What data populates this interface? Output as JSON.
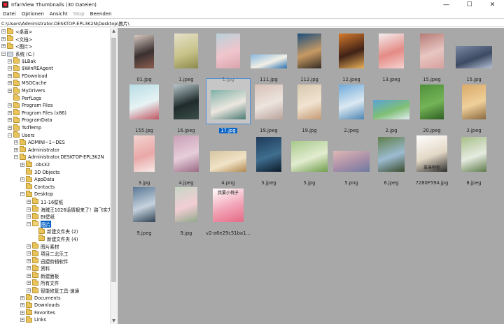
{
  "window": {
    "title": "IrfanView Thumbnails (30 Dateien)"
  },
  "menu": [
    "Datei",
    "Optionen",
    "Ansicht",
    "Stop",
    "Beenden"
  ],
  "path": "C:\\Users\\Administrator.DESKTOP-EPL3K2N\\Desktop\\图片\\",
  "tree": [
    {
      "label": "<桌面>",
      "expander": "+",
      "icon": "folder-icon"
    },
    {
      "label": "<文档>",
      "expander": "+",
      "icon": "folder-icon"
    },
    {
      "label": "<图片>",
      "expander": "+",
      "icon": "folder-icon"
    },
    {
      "label": "系统 (C:)",
      "expander": "−",
      "icon": "drive-icon"
    },
    {
      "label": "$LBak",
      "expander": "+",
      "icon": "folder-icon"
    },
    {
      "label": "$WinREAgent",
      "expander": "+",
      "icon": "folder-icon"
    },
    {
      "label": "FDownload",
      "expander": "+",
      "icon": "folder-icon"
    },
    {
      "label": "MSOCache",
      "expander": "+",
      "icon": "folder-icon"
    },
    {
      "label": "MyDrivers",
      "expander": "+",
      "icon": "folder-icon"
    },
    {
      "label": "PerfLogs",
      "expander": "",
      "icon": "folder-icon"
    },
    {
      "label": "Program Files",
      "expander": "+",
      "icon": "folder-icon"
    },
    {
      "label": "Program Files (x86)",
      "expander": "+",
      "icon": "folder-icon"
    },
    {
      "label": "ProgramData",
      "expander": "+",
      "icon": "folder-icon"
    },
    {
      "label": "TsdTemp",
      "expander": "+",
      "icon": "folder-icon"
    },
    {
      "label": "Users",
      "expander": "−",
      "icon": "folder-icon"
    },
    {
      "label": "ADMINI~1~DES",
      "expander": "+",
      "icon": "folder-icon"
    },
    {
      "label": "Administrator",
      "expander": "+",
      "icon": "folder-icon"
    },
    {
      "label": "Administrator.DESKTOP-EPL3K2N",
      "expander": "−",
      "icon": "folder-icon"
    },
    {
      "label": ".obs32",
      "expander": "+",
      "icon": "folder-icon"
    },
    {
      "label": "3D Objects",
      "expander": "",
      "icon": "folder-icon"
    },
    {
      "label": "AppData",
      "expander": "+",
      "icon": "folder-icon"
    },
    {
      "label": "Contacts",
      "expander": "",
      "icon": "folder-icon"
    },
    {
      "label": "Desktop",
      "expander": "−",
      "icon": "folder-icon"
    },
    {
      "label": "11-16壁纸",
      "expander": "+",
      "icon": "folder-icon"
    },
    {
      "label": "海贼王1026话情报来了！路飞实力",
      "expander": "+",
      "icon": "folder-icon"
    },
    {
      "label": "Bt壁纸",
      "expander": "+",
      "icon": "folder-icon"
    },
    {
      "label": "图片",
      "expander": "−",
      "icon": "folder-icon",
      "selected": true
    },
    {
      "label": "新建文件夹 (2)",
      "expander": "",
      "icon": "folder-icon"
    },
    {
      "label": "新建文件夹 (4)",
      "expander": "",
      "icon": "folder-icon"
    },
    {
      "label": "图片素材",
      "expander": "+",
      "icon": "folder-icon"
    },
    {
      "label": "项目二北乐工",
      "expander": "+",
      "icon": "folder-icon"
    },
    {
      "label": "迅捷剪辑软件",
      "expander": "+",
      "icon": "folder-icon"
    },
    {
      "label": "资料",
      "expander": "+",
      "icon": "folder-icon"
    },
    {
      "label": "新建面板",
      "expander": "+",
      "icon": "folder-icon"
    },
    {
      "label": "所有文件",
      "expander": "+",
      "icon": "folder-icon"
    },
    {
      "label": "智能修复工具-速通",
      "expander": "+",
      "icon": "folder-icon"
    },
    {
      "label": "Documents",
      "expander": "+",
      "icon": "folder-icon"
    },
    {
      "label": "Downloads",
      "expander": "+",
      "icon": "folder-icon"
    },
    {
      "label": "Favorites",
      "expander": "+",
      "icon": "folder-icon"
    },
    {
      "label": "Links",
      "expander": "+",
      "icon": "folder-icon"
    }
  ],
  "thumbnails": [
    {
      "name": "01.jpg",
      "w": 28,
      "h": 48,
      "colors": [
        "#d8c9c0",
        "#3a3030",
        "#8d5e4f"
      ]
    },
    {
      "name": "1.jpeg",
      "w": 34,
      "h": 50,
      "colors": [
        "#e5e0c9",
        "#c8c38a",
        "#8d8a4c"
      ]
    },
    {
      "name": "1.jpg",
      "w": 34,
      "h": 50,
      "colors": [
        "#b8d0d9",
        "#f0c6cc",
        "#d9a3ad"
      ]
    },
    {
      "name": "111.jpg",
      "w": 52,
      "h": 20,
      "colors": [
        "#8ab7e0",
        "#f2f0e6",
        "#2a6fb0"
      ]
    },
    {
      "name": "112.jpg",
      "w": 34,
      "h": 50,
      "colors": [
        "#1d4f7d",
        "#c79a64",
        "#332a22"
      ]
    },
    {
      "name": "12.jpeg",
      "w": 36,
      "h": 50,
      "colors": [
        "#d67a2c",
        "#402217",
        "#e9b15a"
      ]
    },
    {
      "name": "13.jpeg",
      "w": 36,
      "h": 50,
      "colors": [
        "#f4eeee",
        "#e48b86",
        "#f6d3d0"
      ]
    },
    {
      "name": "15.jpeg",
      "w": 34,
      "h": 50,
      "colors": [
        "#b57b76",
        "#e8c6c3",
        "#d6a09c"
      ]
    },
    {
      "name": "15.jpg",
      "w": 52,
      "h": 32,
      "colors": [
        "#7d8aa4",
        "#3d4a63",
        "#b6c1d3"
      ]
    },
    {
      "name": "155.jpg",
      "w": 42,
      "h": 50,
      "colors": [
        "#b7dde4",
        "#e7f3f4",
        "#c05560"
      ]
    },
    {
      "name": "16.jpeg",
      "w": 36,
      "h": 50,
      "colors": [
        "#b8c7cc",
        "#1f2b2b",
        "#3d4f4a"
      ]
    },
    {
      "name": "17.jpg",
      "w": 50,
      "h": 42,
      "colors": [
        "#7fb0a7",
        "#ece7df",
        "#4a7a73"
      ],
      "selected": true
    },
    {
      "name": "19.jpeg",
      "w": 40,
      "h": 50,
      "colors": [
        "#d7c1b6",
        "#ece4de",
        "#b9a39b"
      ]
    },
    {
      "name": "19.jpg",
      "w": 34,
      "h": 50,
      "colors": [
        "#d8c8b0",
        "#f0e3d0",
        "#c49a74"
      ]
    },
    {
      "name": "2.jpeg",
      "w": 36,
      "h": 50,
      "colors": [
        "#6fa9d9",
        "#dbe9f2",
        "#4c85b3"
      ]
    },
    {
      "name": "2.jpg",
      "w": 52,
      "h": 28,
      "colors": [
        "#5aa3d6",
        "#7fbf75",
        "#e2ecf2"
      ]
    },
    {
      "name": "20.jpeg",
      "w": 34,
      "h": 50,
      "colors": [
        "#4f8f3a",
        "#74b457",
        "#2e5e22"
      ]
    },
    {
      "name": "3.jpeg",
      "w": 34,
      "h": 50,
      "colors": [
        "#d9a96a",
        "#efd09a",
        "#8a6a40"
      ]
    },
    {
      "name": "3.jpg",
      "w": 30,
      "h": 52,
      "colors": [
        "#f2d3d0",
        "#e9a8a8",
        "#f8ebe8"
      ]
    },
    {
      "name": "4.jpeg",
      "w": 36,
      "h": 52,
      "colors": [
        "#caa0b8",
        "#e6cdd9",
        "#9a6b85"
      ]
    },
    {
      "name": "4.png",
      "w": 52,
      "h": 30,
      "colors": [
        "#d6c4a0",
        "#f0e3c6",
        "#b08850"
      ]
    },
    {
      "name": "5.jpeg",
      "w": 36,
      "h": 50,
      "colors": [
        "#1e3a5a",
        "#3f6e8e",
        "#0c1a2a"
      ]
    },
    {
      "name": "5.jpg",
      "w": 52,
      "h": 44,
      "colors": [
        "#a7c98a",
        "#e2ecd0",
        "#6f9d4a"
      ]
    },
    {
      "name": "5.png",
      "w": 52,
      "h": 30,
      "colors": [
        "#e0b7b5",
        "#a88fa8",
        "#6d7aa0"
      ]
    },
    {
      "name": "6.jpeg",
      "w": 38,
      "h": 50,
      "colors": [
        "#5f7f4a",
        "#9dbbd1",
        "#3a4d2c"
      ]
    },
    {
      "name": "7280F594.jpg",
      "w": 44,
      "h": 52,
      "colors": [
        "#ffffff",
        "#e2d7c5",
        "#2b2b2b"
      ],
      "text": "拿来吧你"
    },
    {
      "name": "8.jpeg",
      "w": 36,
      "h": 50,
      "colors": [
        "#a7bf8a",
        "#e5ebe0",
        "#5d7a4a"
      ]
    },
    {
      "name": "9.jpeg",
      "w": 32,
      "h": 50,
      "colors": [
        "#5a7896",
        "#c6d2dd",
        "#2f4153"
      ]
    },
    {
      "name": "9.jpg",
      "w": 32,
      "h": 50,
      "colors": [
        "#c6d6c4",
        "#f2cdd4",
        "#8fa88a"
      ]
    },
    {
      "name": "v2-a6e29c51ba1...",
      "w": 44,
      "h": 48,
      "colors": [
        "#ffffff",
        "#f2a3b6",
        "#e56a86"
      ],
      "text": "我要小桃子"
    }
  ]
}
